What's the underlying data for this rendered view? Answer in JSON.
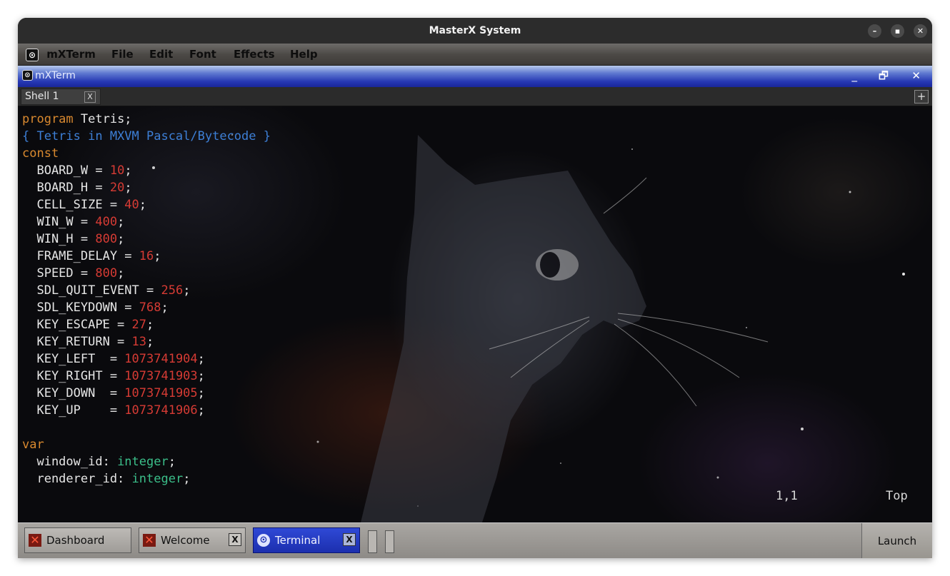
{
  "window": {
    "title": "MasterX System"
  },
  "menubar": {
    "app": "mXTerm",
    "items": [
      "File",
      "Edit",
      "Font",
      "Effects",
      "Help"
    ]
  },
  "term_window": {
    "title": "mXTerm"
  },
  "tabs": {
    "items": [
      {
        "label": "Shell 1"
      }
    ],
    "close_glyph": "X",
    "add_glyph": "+"
  },
  "editor": {
    "lines": [
      [
        {
          "c": "kw",
          "t": "program"
        },
        {
          "t": " Tetris;"
        }
      ],
      [
        {
          "c": "cm",
          "t": "{ Tetris in MXVM Pascal/Bytecode }"
        }
      ],
      [
        {
          "c": "kw",
          "t": "const"
        }
      ],
      [
        {
          "t": "  BOARD_W = "
        },
        {
          "c": "num",
          "t": "10"
        },
        {
          "t": ";"
        }
      ],
      [
        {
          "t": "  BOARD_H = "
        },
        {
          "c": "num",
          "t": "20"
        },
        {
          "t": ";"
        }
      ],
      [
        {
          "t": "  CELL_SIZE = "
        },
        {
          "c": "num",
          "t": "40"
        },
        {
          "t": ";"
        }
      ],
      [
        {
          "t": "  WIN_W = "
        },
        {
          "c": "num",
          "t": "400"
        },
        {
          "t": ";"
        }
      ],
      [
        {
          "t": "  WIN_H = "
        },
        {
          "c": "num",
          "t": "800"
        },
        {
          "t": ";"
        }
      ],
      [
        {
          "t": "  FRAME_DELAY = "
        },
        {
          "c": "num",
          "t": "16"
        },
        {
          "t": ";"
        }
      ],
      [
        {
          "t": "  SPEED = "
        },
        {
          "c": "num",
          "t": "800"
        },
        {
          "t": ";"
        }
      ],
      [
        {
          "t": "  SDL_QUIT_EVENT = "
        },
        {
          "c": "num",
          "t": "256"
        },
        {
          "t": ";"
        }
      ],
      [
        {
          "t": "  SDL_KEYDOWN = "
        },
        {
          "c": "num",
          "t": "768"
        },
        {
          "t": ";"
        }
      ],
      [
        {
          "t": "  KEY_ESCAPE = "
        },
        {
          "c": "num",
          "t": "27"
        },
        {
          "t": ";"
        }
      ],
      [
        {
          "t": "  KEY_RETURN = "
        },
        {
          "c": "num",
          "t": "13"
        },
        {
          "t": ";"
        }
      ],
      [
        {
          "t": "  KEY_LEFT  = "
        },
        {
          "c": "num",
          "t": "1073741904"
        },
        {
          "t": ";"
        }
      ],
      [
        {
          "t": "  KEY_RIGHT = "
        },
        {
          "c": "num",
          "t": "1073741903"
        },
        {
          "t": ";"
        }
      ],
      [
        {
          "t": "  KEY_DOWN  = "
        },
        {
          "c": "num",
          "t": "1073741905"
        },
        {
          "t": ";"
        }
      ],
      [
        {
          "t": "  KEY_UP    = "
        },
        {
          "c": "num",
          "t": "1073741906"
        },
        {
          "t": ";"
        }
      ],
      [],
      [
        {
          "c": "kw",
          "t": "var"
        }
      ],
      [
        {
          "t": "  window_id: "
        },
        {
          "c": "ty",
          "t": "integer"
        },
        {
          "t": ";"
        }
      ],
      [
        {
          "t": "  renderer_id: "
        },
        {
          "c": "ty",
          "t": "integer"
        },
        {
          "t": ";"
        }
      ]
    ],
    "cursor": "1,1",
    "scroll": "Top"
  },
  "taskbar": {
    "buttons": [
      {
        "label": "Dashboard",
        "icon": "x-app-icon",
        "active": false,
        "closable": false
      },
      {
        "label": "Welcome",
        "icon": "x-app-icon",
        "active": false,
        "closable": true
      },
      {
        "label": "Terminal",
        "icon": "terminal-icon",
        "active": true,
        "closable": true
      }
    ],
    "close_glyph": "X",
    "launch": "Launch"
  },
  "colors": {
    "keyword": "#d9892f",
    "comment": "#3d7fd6",
    "number": "#d63b34",
    "type": "#3bbf8a",
    "active_task": "#1f34c4"
  }
}
